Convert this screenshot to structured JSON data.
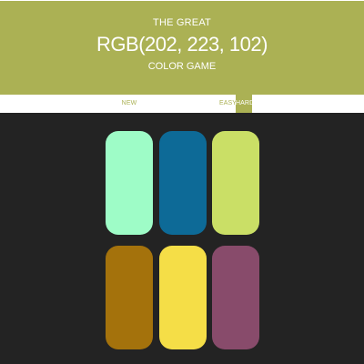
{
  "header": {
    "title_top": "THE GREAT",
    "title_rgb": "RGB(202, 223, 102)",
    "title_bottom": "COLOR GAME",
    "background": "#abb154"
  },
  "controls": {
    "new_colors_label": "NEW COLORS",
    "easy_label": "EASY",
    "hard_label": "HARD",
    "selected_mode": "HARD",
    "accent": "#abb154"
  },
  "squares": [
    {
      "color": "#9efcc7"
    },
    {
      "color": "#0d6a97"
    },
    {
      "color": "#cadf66"
    },
    {
      "color": "#a4720c"
    },
    {
      "color": "#f5de47"
    },
    {
      "color": "#884b6b"
    }
  ]
}
